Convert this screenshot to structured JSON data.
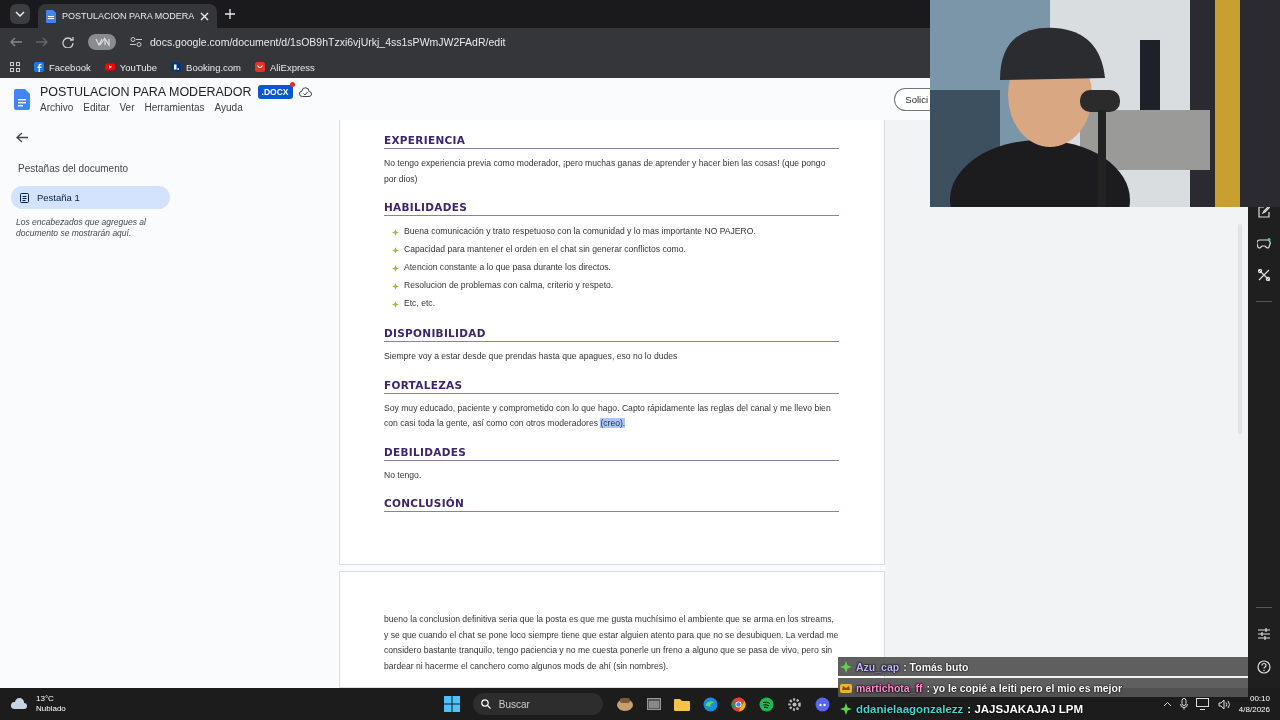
{
  "browser": {
    "tab_title": "POSTULACION PARA MODERA",
    "url": "docs.google.com/document/d/1sOB9hTzxi6vjUrkj_4ss1sPWmJW2FAdR/edit",
    "bookmarks": [
      {
        "label": "Facebook",
        "kind": "facebook"
      },
      {
        "label": "YouTube",
        "kind": "youtube"
      },
      {
        "label": "Booking.com",
        "kind": "booking"
      },
      {
        "label": "AliExpress",
        "kind": "aliexpress"
      }
    ]
  },
  "docs": {
    "title": "POSTULACION PARA MODERADOR",
    "badge": ".DOCX",
    "menus": [
      "Archivo",
      "Editar",
      "Ver",
      "Herramientas",
      "Ayuda"
    ],
    "share_button": "Solici"
  },
  "sidebar": {
    "heading": "Pestañas del documento",
    "tabs": [
      {
        "label": "Pestaña 1",
        "selected": true
      }
    ],
    "hint": "Los encabezados que agregues al documento se mostrarán aquí."
  },
  "document": {
    "sections": [
      {
        "heading": "EXPERIENCIA",
        "paragraphs": [
          {
            "text": "No tengo experiencia previa como moderador, ¡pero muchas ganas de aprender y hacer bien las cosas! (que pongo por dios)"
          }
        ]
      },
      {
        "heading": "HABILIDADES",
        "bullets": [
          "Buena comunicación y trato respetuoso con la comunidad y lo mas importante NO PAJERO.",
          "Capacidad para mantener el orden en el chat sin generar conflictos como.",
          "Atencion constante a lo que pasa durante los directos.",
          "Resolucion de problemas con calma, criterio y respeto.",
          "Etc, etc."
        ]
      },
      {
        "heading": "DISPONIBILIDAD",
        "paragraphs": [
          {
            "text": "Siempre voy a estar desde que prendas hasta que apagues, eso no lo dudes"
          }
        ]
      },
      {
        "heading": "FORTALEZAS",
        "paragraphs": [
          {
            "text": "Soy muy educado, paciente y comprometido con lo que hago. Capto rápidamente las reglas del canal y me llevo bien con casi toda la gente, así como con otros moderadores ",
            "selection": "(creo)."
          }
        ]
      },
      {
        "heading": "DEBILIDADES",
        "paragraphs": [
          {
            "text": "No tengo."
          }
        ]
      },
      {
        "heading": "CONCLUSIÓN"
      }
    ],
    "page2": [
      {
        "text": "bueno la conclusion definitiva seria que la posta es que me gusta muchísimo el ambiente que se arma en los streams, y se que cuando el chat se pone loco siempre tiene que estar alguien atento para que no se desubiquen. La verdad me considero bastante tranquilo, tengo paciencia y no me cuesta ponerle un freno a alguno que se pasa de vivo, pero sin bardear ni hacerme el canchero como algunos mods de ahí (sin nombres)."
      }
    ]
  },
  "chat": [
    {
      "kind": "star",
      "user": "Azu_cap",
      "color": "#c2b9ff",
      "message": ": Tomás buto",
      "banded": true
    },
    {
      "kind": "crown",
      "user": "martichota_ff",
      "color": "#ff8fd0",
      "message": ": yo le copié a leiti pero el mio es mejor",
      "banded": true
    },
    {
      "kind": "star",
      "user": "ddanielaagonzalezz",
      "color": "#3fd9cf",
      "message": ": JAJSJAKAJAJ LPM",
      "banded": false
    }
  ],
  "taskbar": {
    "temperature": "13°C",
    "weather": "Nublado",
    "search_placeholder": "Buscar",
    "time": "00:10",
    "date": "4/8/2026"
  }
}
